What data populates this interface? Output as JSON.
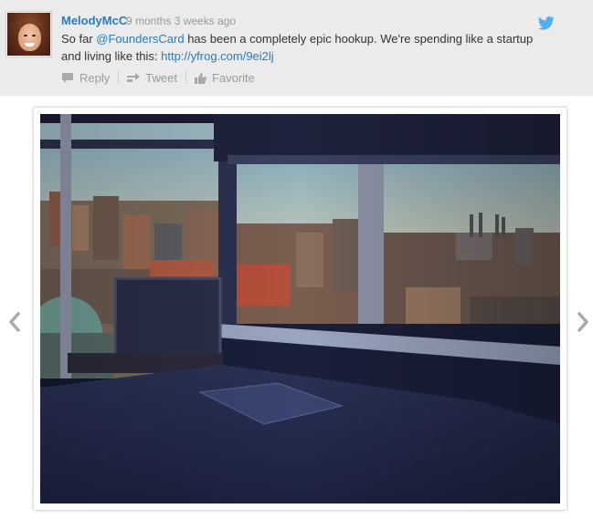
{
  "tweet": {
    "username": "MelodyMcC",
    "timestamp": "9 months 3 weeks ago",
    "text_prefix": "So far ",
    "mention": "@FoundersCard",
    "text_middle": " has been a completely epic hookup. We're spending like a startup and living like this: ",
    "link": "http://yfrog.com/9ei2lj"
  },
  "actions": {
    "reply_label": "Reply",
    "tweet_label": "Tweet",
    "favorite_label": "Favorite"
  },
  "icons": {
    "brand": "twitter-bird-icon",
    "reply": "reply-icon",
    "retweet": "retweet-icon",
    "favorite": "thumbs-up-icon",
    "prev": "chevron-left-icon",
    "next": "chevron-right-icon"
  },
  "colors": {
    "username": "#2b7bb9",
    "link": "#2b7bb9",
    "card_background": "#ebebeb",
    "twitter_brand": "#55acee",
    "action_gray": "#9a9a9a"
  }
}
